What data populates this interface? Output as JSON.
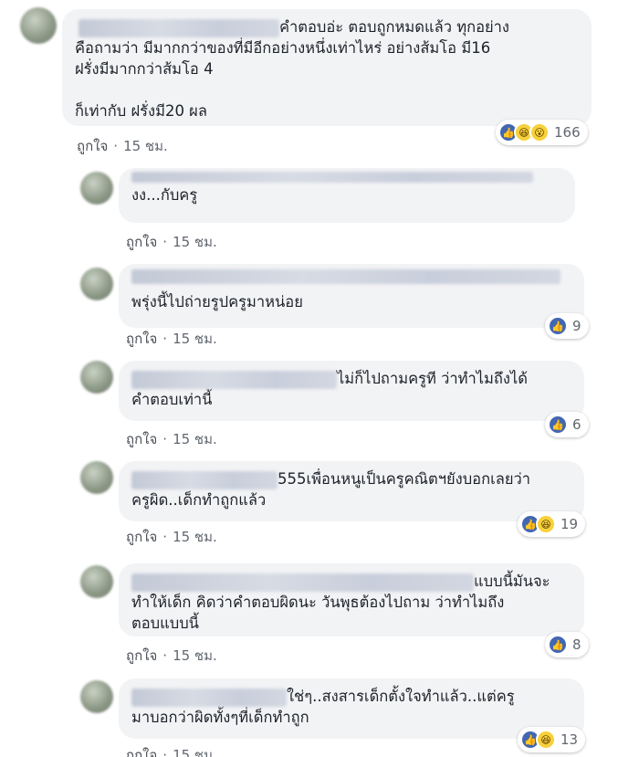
{
  "meta": {
    "like_label": "ถูกใจ",
    "dot": "·",
    "time": "15 ชม."
  },
  "comments": [
    {
      "text": "คำตอบอ่ะ ตอบถูกหมดแล้ว ทุกอย่าง\nคือถามว่า มีมากกว่าของที่มีอีกอย่างหนึ่งเท่าไหร่ อย่างส้มโอ มี16\nฝรั่งมีมากกว่าส้มโอ 4\n\nก็เท่ากับ ฝรั่งมี20 ผล",
      "reaction_count": "166",
      "reactions": [
        "like",
        "haha",
        "wow"
      ]
    },
    {
      "text": "งง...กับครู",
      "reaction_count": "",
      "reactions": []
    },
    {
      "text": "พรุ่งนี้ไปถ่ายรูปครูมาหน่อย",
      "reaction_count": "9",
      "reactions": [
        "like"
      ]
    },
    {
      "text": "ไม่ก็ไปถามครูที ว่าทำไมถึงได้\nคำตอบเท่านี้",
      "reaction_count": "6",
      "reactions": [
        "like"
      ]
    },
    {
      "text": "555เพื่อนหนูเป็นครูคณิตฯยังบอกเลยว่า\nครูผิด..เด็กทำถูกแล้ว",
      "reaction_count": "19",
      "reactions": [
        "like",
        "haha"
      ]
    },
    {
      "text": "แบบนี้มันจะ\nทำให้เด็ก คิดว่าคำตอบผิดนะ วันพุธต้องไปถาม ว่าทำไมถึง\nตอบแบบนี้",
      "reaction_count": "8",
      "reactions": [
        "like"
      ]
    },
    {
      "text": "ใช่ๆ..สงสารเด็กตั้งใจทำแล้ว..แต่ครู\nมาบอกว่าผิดทั้งๆที่เด็กทำถูก",
      "reaction_count": "13",
      "reactions": [
        "like",
        "haha"
      ]
    }
  ]
}
